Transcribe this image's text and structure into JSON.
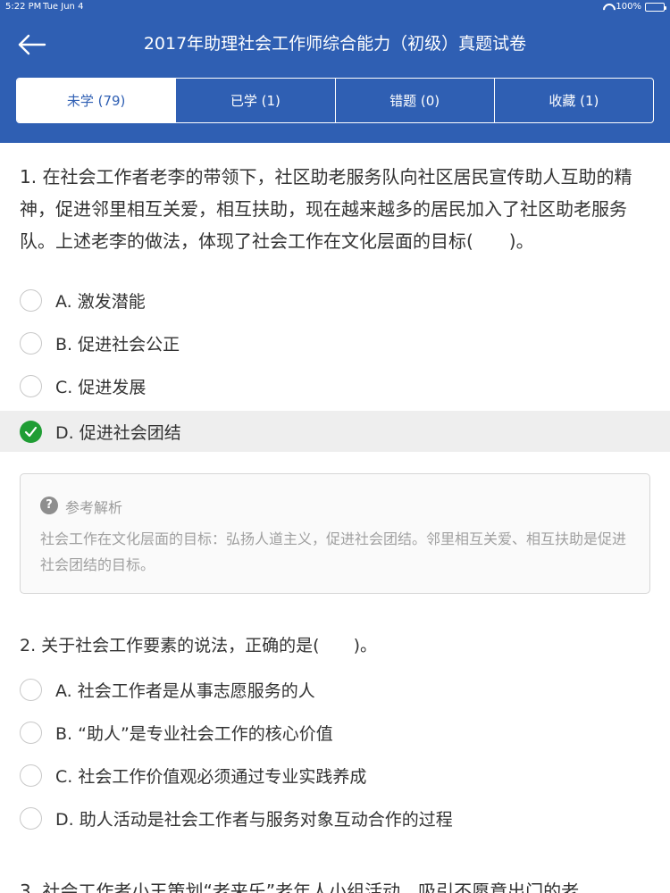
{
  "status_bar": {
    "time": "5:22 PM",
    "date": "Tue Jun 4",
    "battery": "100%"
  },
  "header": {
    "title": "2017年助理社会工作师综合能力（初级）真题试卷"
  },
  "tabs": [
    {
      "label": "未学 (79)",
      "active": true
    },
    {
      "label": "已学 (1)",
      "active": false
    },
    {
      "label": "错题 (0)",
      "active": false
    },
    {
      "label": "收藏 (1)",
      "active": false
    }
  ],
  "colors": {
    "primary": "#2f5fb3",
    "correct": "#1f9d34"
  },
  "questions": [
    {
      "text": "1. 在社会工作者老李的带领下，社区助老服务队向社区居民宣传助人互助的精神，促进邻里相互关爱，相互扶助，现在越来越多的居民加入了社区助老服务队。上述老李的做法，体现了社会工作在文化层面的目标(　　)。",
      "options": [
        {
          "label": "A. 激发潜能",
          "selected": false
        },
        {
          "label": "B. 促进社会公正",
          "selected": false
        },
        {
          "label": "C. 促进发展",
          "selected": false
        },
        {
          "label": "D. 促进社会团结",
          "selected": true
        }
      ],
      "analysis": {
        "heading": "参考解析",
        "body": "社会工作在文化层面的目标：弘扬人道主义，促进社会团结。邻里相互关爱、相互扶助是促进社会团结的目标。"
      }
    },
    {
      "text": "2. 关于社会工作要素的说法，正确的是(　　)。",
      "options": [
        {
          "label": "A. 社会工作者是从事志愿服务的人",
          "selected": false
        },
        {
          "label": "B. “助人”是专业社会工作的核心价值",
          "selected": false
        },
        {
          "label": "C. 社会工作价值观必须通过专业实践养成",
          "selected": false
        },
        {
          "label": "D. 助人活动是社会工作者与服务对象互动合作的过程",
          "selected": false
        }
      ]
    },
    {
      "text": "3. 社会工作者小王策划“老来乐”老年人小组活动，吸引不愿意出门的老"
    }
  ]
}
